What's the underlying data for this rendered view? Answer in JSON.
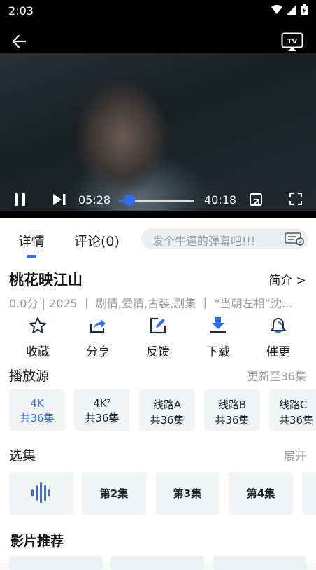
{
  "status_bar": {
    "time": "2:03"
  },
  "player": {
    "current_time": "05:28",
    "total_time": "40:18",
    "progress": 0.14
  },
  "tabs": {
    "detail": "详情",
    "comments": "评论(0)"
  },
  "danmu": {
    "placeholder": "发个牛逼的弹幕吧!!!"
  },
  "info": {
    "title": "桃花映江山",
    "intro_link": "简介 >",
    "meta": "0.0分  | 2025  丨 剧情,爱情,古装,剧集  丨 “当朝左相”沈..."
  },
  "actions": [
    {
      "icon": "star-icon",
      "label": "收藏"
    },
    {
      "icon": "share-icon",
      "label": "分享"
    },
    {
      "icon": "edit-icon",
      "label": "反馈"
    },
    {
      "icon": "download-icon",
      "label": "下载"
    },
    {
      "icon": "bell-icon",
      "label": "催更"
    }
  ],
  "sources": {
    "title": "播放源",
    "update_text": "更新至36集",
    "items": [
      {
        "name": "4K",
        "count": "共36集",
        "active": true
      },
      {
        "name": "4K²",
        "count": "共36集",
        "active": false
      },
      {
        "name": "线路A",
        "count": "共36集",
        "active": false
      },
      {
        "name": "线路B",
        "count": "共36集",
        "active": false
      },
      {
        "name": "线路C",
        "count": "共36集",
        "active": false
      }
    ]
  },
  "episodes": {
    "title": "选集",
    "expand": "展开",
    "items": [
      "第2集",
      "第3集",
      "第4集"
    ]
  },
  "recommend": {
    "title": "影片推荐"
  },
  "colors": {
    "accent": "#2f6df6"
  }
}
